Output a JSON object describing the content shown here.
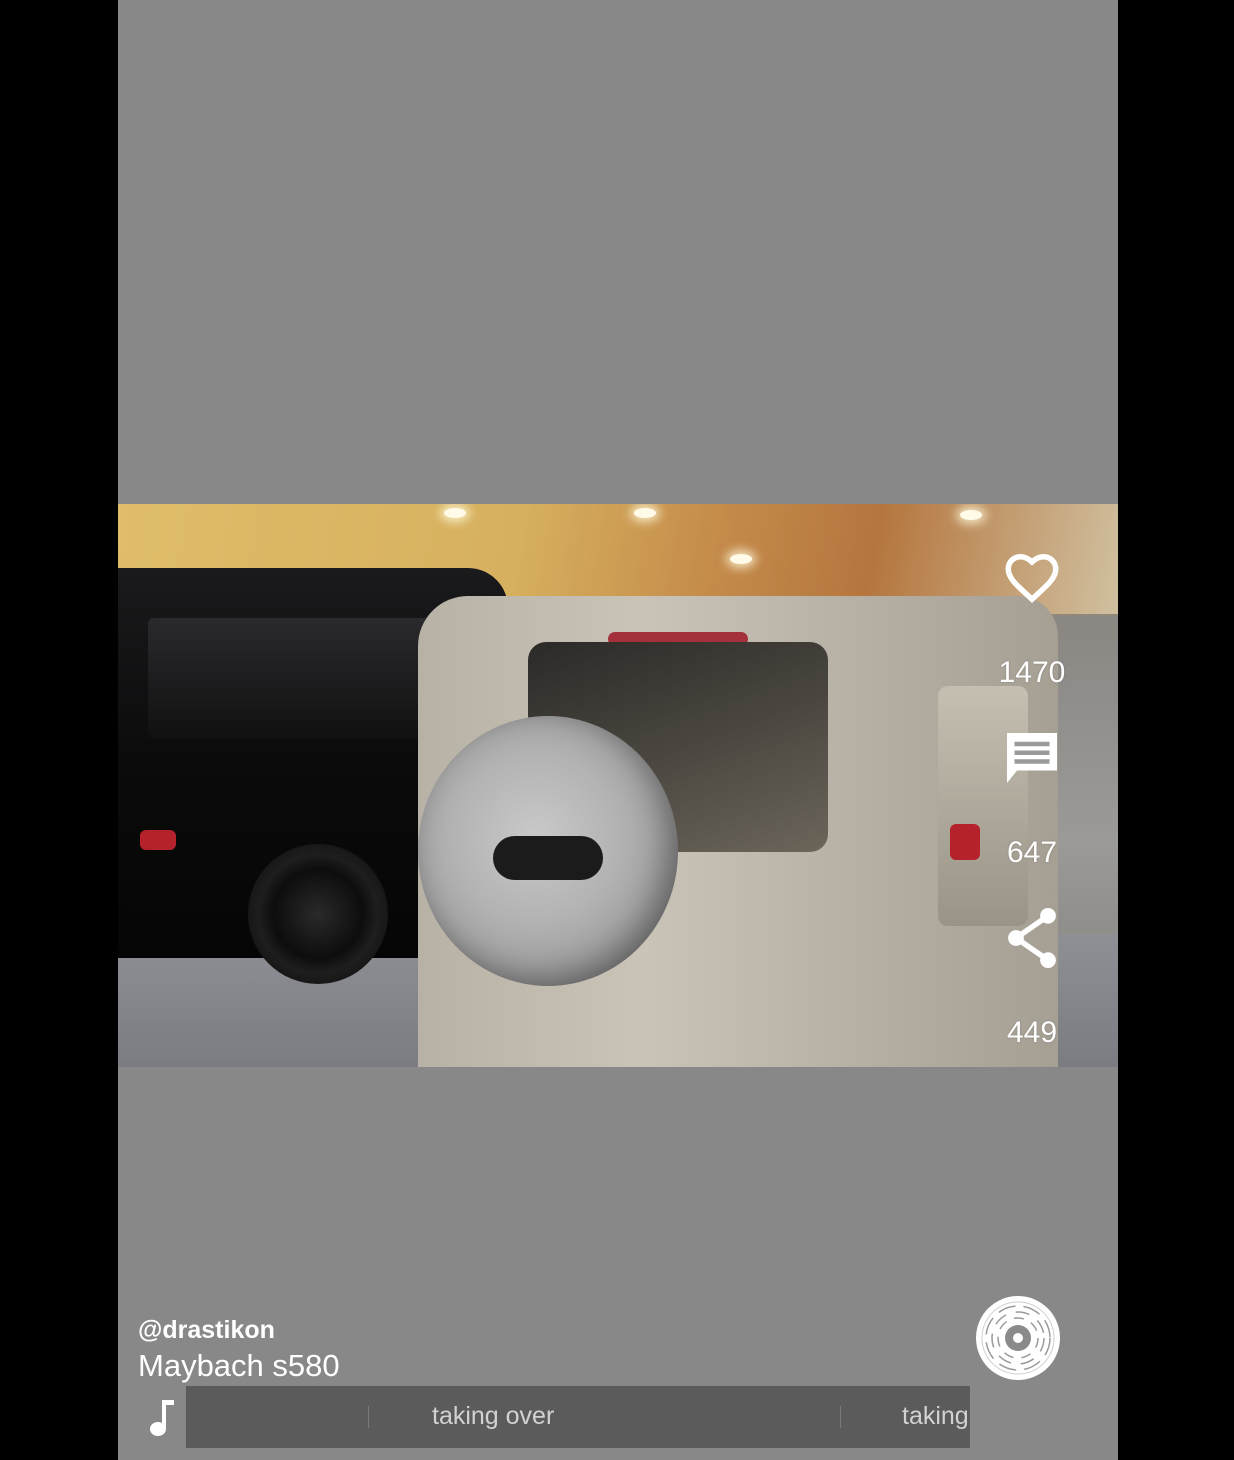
{
  "post": {
    "username": "@drastikon",
    "caption": "Maybach s580",
    "music_track": "taking over"
  },
  "actions": {
    "likes": "1470",
    "comments": "647",
    "shares": "449"
  },
  "icons": {
    "like": "heart-icon",
    "comment": "comment-icon",
    "share": "share-icon",
    "music": "music-note-icon",
    "disc": "music-disc-icon"
  },
  "colors": {
    "background": "#000000",
    "stage": "#888888",
    "music_strip": "#5b5b5b",
    "text": "#ffffff"
  }
}
